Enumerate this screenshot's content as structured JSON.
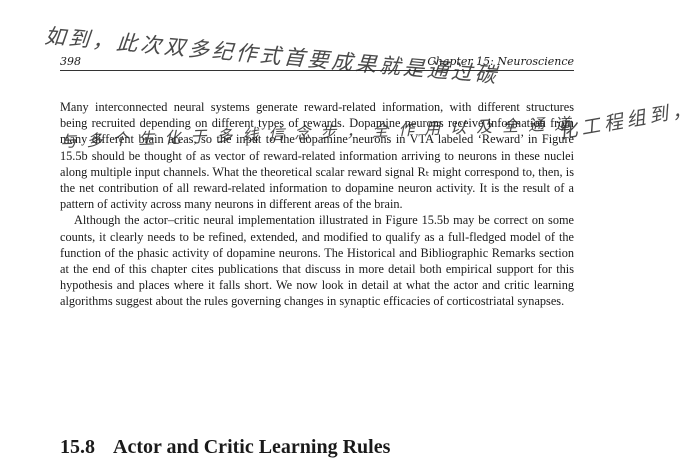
{
  "header": {
    "page_number": "398",
    "chapter_title": "Chapter 15: Neuroscience"
  },
  "paragraphs": [
    "Many interconnected neural systems generate reward-related information, with different structures being recruited depending on different types of rewards. Dopamine neurons receive information from many different brain areas, so the input to the dopamine neurons in VTA labeled ‘Reward’ in Figure 15.5b should be thought of as vector of reward-related information arriving to neurons in these nuclei along multiple input channels. What the theoretical scalar reward signal Rₜ might correspond to, then, is the net contribution of all reward-related information to dopamine neuron activity. It is the result of a pattern of activity across many neurons in different areas of the brain.",
    "Although the actor–critic neural implementation illustrated in Figure 15.5b may be correct on some counts, it clearly needs to be refined, extended, and modified to qualify as a full-fledged model of the function of the phasic activity of dopamine neurons. The Historical and Bibliographic Remarks section at the end of this chapter cites publications that discuss in more detail both empirical support for this hypothesis and places where it falls short. We now look in detail at what the actor and critic learning algorithms suggest about the rules governing changes in synaptic efficacies of corticostriatal synapses."
  ],
  "section": {
    "number": "15.8",
    "title": "Actor and Critic Learning Rules"
  },
  "handwritten_annotations": [
    "如到，此次双多纪作式首要成果就是通过碳",
    "与多个生化于多线信念步，全作用以及全通道",
    "化工程组到，著不见，"
  ]
}
